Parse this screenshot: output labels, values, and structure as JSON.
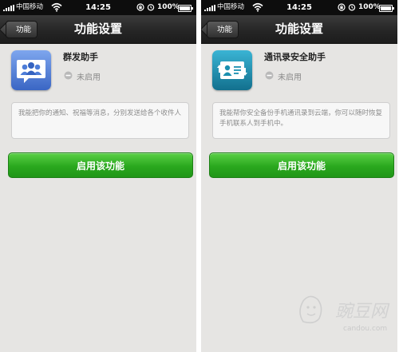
{
  "colors": {
    "status_bar_bg": "#0d0d0d",
    "nav_bar_bg": "#262626",
    "page_bg": "#e6e5e3",
    "button_green": "#2aa81e",
    "left_icon_blue": "#4d7dd8",
    "right_icon_teal": "#1a8fb0"
  },
  "screens": [
    {
      "status_bar": {
        "carrier": "中国移动",
        "time": "14:25",
        "battery": "100%"
      },
      "nav": {
        "back_label": "功能",
        "title": "功能设置"
      },
      "feature": {
        "icon": "group-chat-icon",
        "name": "群发助手",
        "status_icon": "disabled-icon",
        "status": "未启用",
        "description": "我能把你的通知、祝福等消息，分别发送给各个收件人"
      },
      "button": {
        "label": "启用该功能"
      }
    },
    {
      "status_bar": {
        "carrier": "中国移动",
        "time": "14:25",
        "battery": "100%"
      },
      "nav": {
        "back_label": "功能",
        "title": "功能设置"
      },
      "feature": {
        "icon": "contact-backup-icon",
        "name": "通讯录安全助手",
        "status_icon": "disabled-icon",
        "status": "未启用",
        "description": "我能帮你安全备份手机通讯录到云端，你可以随时恢复手机联系人到手机中。"
      },
      "button": {
        "label": "启用该功能"
      }
    }
  ],
  "watermark": {
    "name": "豌豆网",
    "site": "candou.com"
  }
}
